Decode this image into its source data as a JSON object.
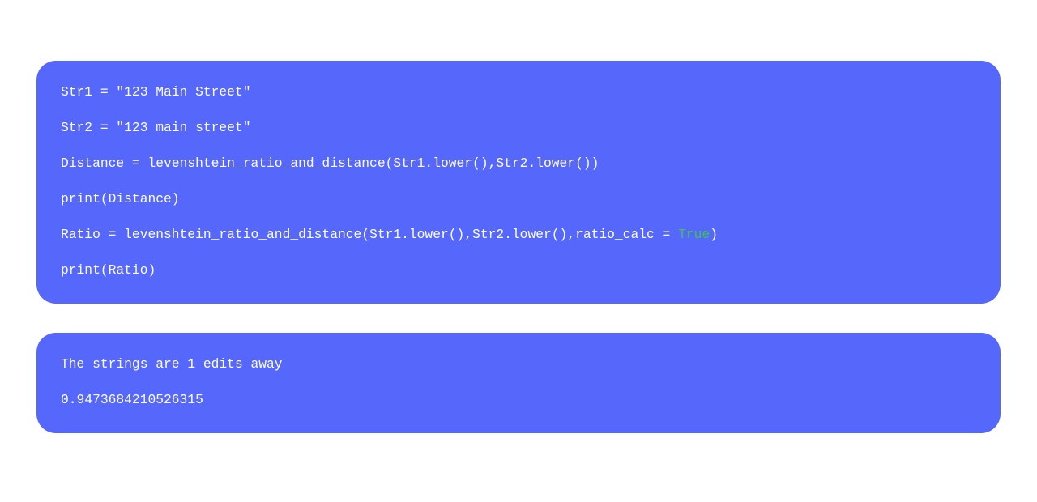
{
  "source": {
    "lines": [
      {
        "plain": "Str1 = \"123 Main Street\""
      },
      {
        "plain": "Str2 = \"123 main street\""
      },
      {
        "plain": "Distance = levenshtein_ratio_and_distance(Str1.lower(),Str2.lower())"
      },
      {
        "plain": "print(Distance)"
      },
      {
        "prefix": "Ratio = levenshtein_ratio_and_distance(Str1.lower(),Str2.lower(),ratio_calc = ",
        "highlight": "True",
        "suffix": ")"
      },
      {
        "plain": "print(Ratio)"
      }
    ]
  },
  "output": {
    "lines": [
      {
        "plain": "The strings are 1 edits away"
      },
      {
        "plain": "0.9473684210526315"
      }
    ]
  }
}
